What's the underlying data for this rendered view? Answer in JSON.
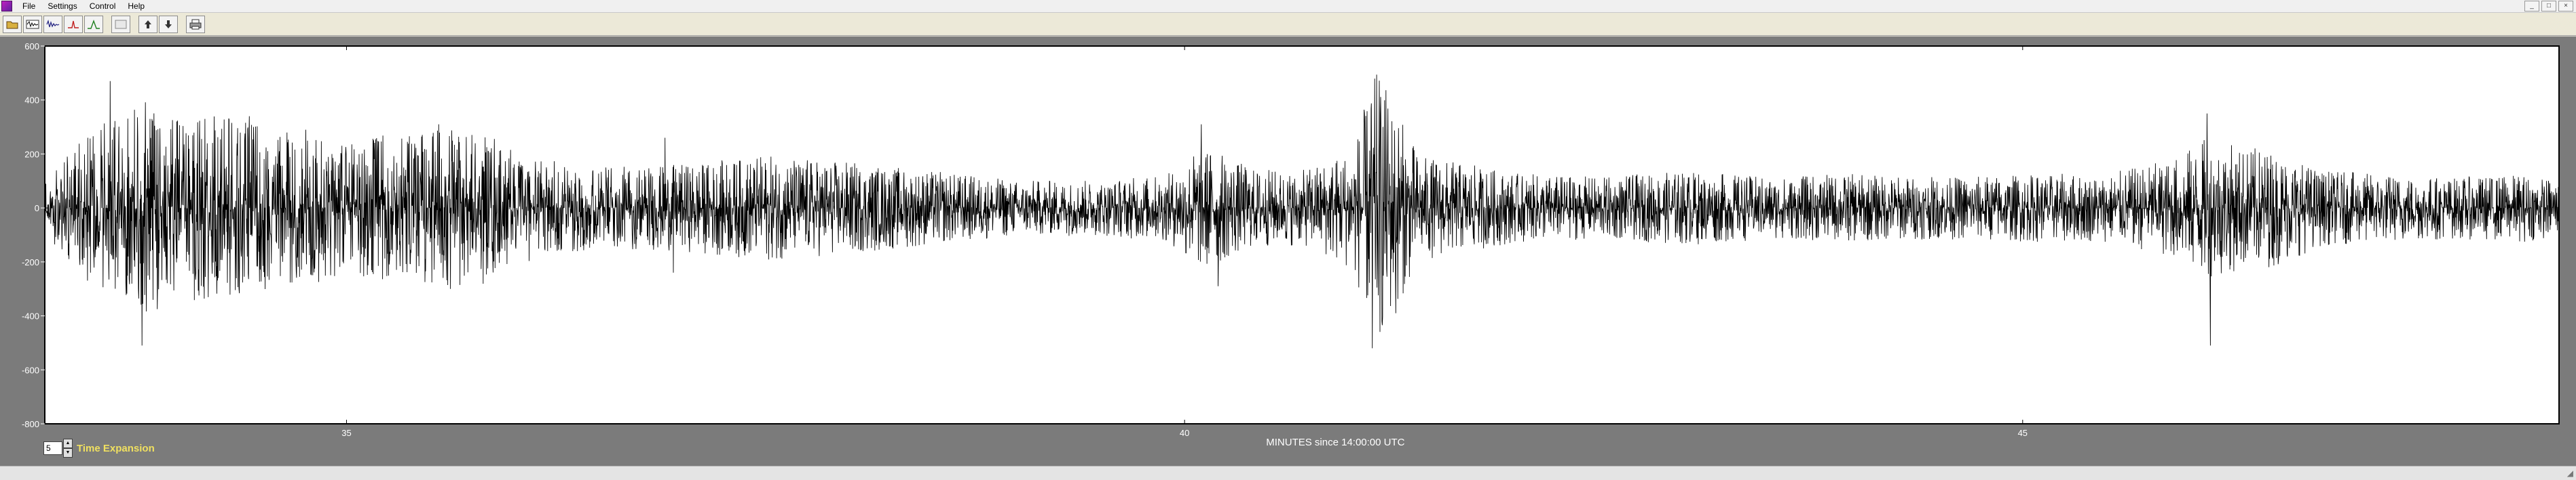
{
  "menu": [
    "File",
    "Settings",
    "Control",
    "Help"
  ],
  "window_controls": [
    "_",
    "□",
    "×"
  ],
  "toolbar": [
    {
      "name": "open-file-button",
      "icon": "folder-icon"
    },
    {
      "name": "seismograph-button",
      "icon": "seismograph-icon"
    },
    {
      "name": "waveform-button",
      "icon": "waveform-icon"
    },
    {
      "name": "filter-button",
      "icon": "filter-icon"
    },
    {
      "name": "spectrum-button",
      "icon": "spectrum-icon"
    },
    {
      "name": "blank-button",
      "icon": "blank-icon"
    },
    {
      "name": "scale-up-button",
      "icon": "arrow-up-icon"
    },
    {
      "name": "scale-down-button",
      "icon": "arrow-down-icon"
    },
    {
      "name": "print-button",
      "icon": "printer-icon"
    }
  ],
  "time_expansion": {
    "value": "5",
    "label": "Time Expansion"
  },
  "chart_data": {
    "type": "line",
    "title": "",
    "xlabel": "MINUTES since 14:00:00 UTC",
    "ylabel": "",
    "xlim": [
      33.2,
      48.2
    ],
    "ylim": [
      -800,
      600
    ],
    "x_ticks": [
      35,
      40,
      45
    ],
    "x_tick_labels": [
      "35",
      "40",
      "45"
    ],
    "y_ticks": [
      600,
      400,
      200,
      0,
      -200,
      -400,
      -600,
      -800
    ],
    "y_tick_labels": [
      "600",
      "400",
      "200",
      "0",
      "-200",
      "-400",
      "-600",
      "-800"
    ],
    "grid": false,
    "series": [
      {
        "color": "#000000",
        "envelope": {
          "x": [
            33.2,
            33.4,
            33.6,
            33.8,
            34.0,
            34.2,
            34.4,
            34.6,
            34.8,
            35.0,
            35.2,
            35.4,
            35.6,
            35.8,
            36.0,
            36.5,
            37.0,
            37.5,
            38.0,
            38.5,
            39.0,
            39.5,
            39.9,
            40.1,
            40.4,
            40.7,
            41.0,
            41.15,
            41.4,
            41.7,
            42.0,
            42.5,
            43.0,
            43.5,
            44.0,
            44.5,
            45.0,
            45.5,
            45.9,
            46.1,
            46.3,
            46.5,
            46.8,
            47.2,
            47.6,
            48.0,
            48.2
          ],
          "amplitude": [
            80,
            210,
            300,
            350,
            300,
            300,
            280,
            250,
            260,
            200,
            240,
            230,
            260,
            260,
            180,
            130,
            140,
            170,
            150,
            120,
            90,
            90,
            110,
            210,
            130,
            120,
            200,
            450,
            170,
            140,
            110,
            100,
            120,
            100,
            110,
            100,
            110,
            110,
            160,
            230,
            200,
            190,
            120,
            110,
            100,
            110,
            90
          ]
        },
        "spikes": [
          {
            "x": 33.59,
            "y": 470
          },
          {
            "x": 33.78,
            "y": -510
          },
          {
            "x": 34.42,
            "y": 340
          },
          {
            "x": 35.55,
            "y": 310
          },
          {
            "x": 35.62,
            "y": -300
          },
          {
            "x": 36.9,
            "y": 260
          },
          {
            "x": 36.95,
            "y": -240
          },
          {
            "x": 40.1,
            "y": 310
          },
          {
            "x": 40.2,
            "y": -290
          },
          {
            "x": 41.12,
            "y": 560
          },
          {
            "x": 41.12,
            "y": -520
          },
          {
            "x": 41.26,
            "y": 430
          },
          {
            "x": 41.26,
            "y": -390
          },
          {
            "x": 46.1,
            "y": 350
          },
          {
            "x": 46.12,
            "y": 440
          },
          {
            "x": 46.12,
            "y": -510
          }
        ]
      }
    ]
  }
}
